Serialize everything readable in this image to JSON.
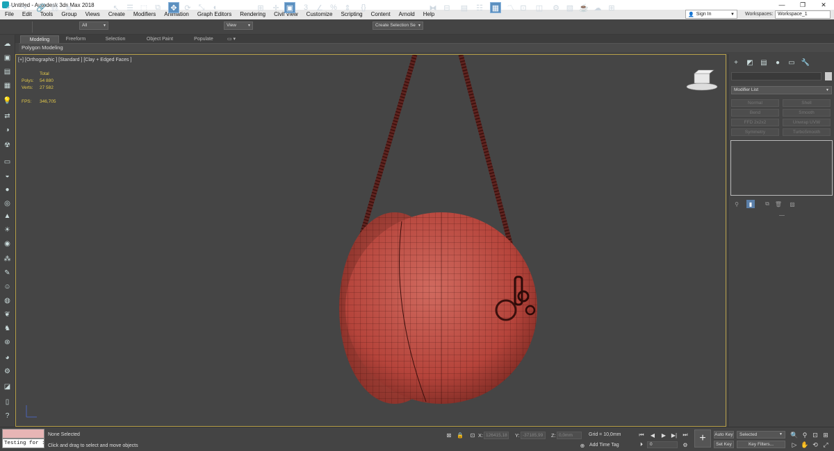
{
  "window": {
    "title": "Untitled - Autodesk 3ds Max 2018",
    "controls": [
      "—",
      "❐",
      "✕"
    ]
  },
  "menu": [
    "File",
    "Edit",
    "Tools",
    "Group",
    "Views",
    "Create",
    "Modifiers",
    "Animation",
    "Graph Editors",
    "Rendering",
    "Civil View",
    "Customize",
    "Scripting",
    "Content",
    "Arnold",
    "Help"
  ],
  "account": {
    "sign_in": "Sign In",
    "workspaces_label": "Workspaces:",
    "workspace": "Workspace_1"
  },
  "toolbar": {
    "selection_filter": "All",
    "reference_coord": "View",
    "named_selection": "Create Selection Se"
  },
  "ribbon": {
    "tabs": [
      "Modeling",
      "Freeform",
      "Selection",
      "Object Paint",
      "Populate"
    ],
    "active_tab": "Modeling",
    "sub_panel": "Polygon Modeling"
  },
  "viewport": {
    "label": "[+] [Orthographic ] [Standard ] [Clay + Edged Faces ]",
    "stats": {
      "total_label": "Total",
      "polys_label": "Polys:",
      "polys": "54 880",
      "verts_label": "Verts:",
      "verts": "27 582",
      "fps_label": "FPS:",
      "fps": "346,705"
    },
    "mesh_color": "#b5443b",
    "wire_color": "#3a0f0c"
  },
  "command_panel": {
    "modifier_list": "Modifier List",
    "modifier_buttons": [
      "Normal",
      "Shell",
      "Bend",
      "Smooth",
      "FFD 2x2x2",
      "Unwrap UVW",
      "Symmetry",
      "TurboSmooth"
    ]
  },
  "status": {
    "script_text": "Testing for :",
    "selection": "None Selected",
    "prompt": "Click and drag to select and move objects",
    "x_label": "X:",
    "x": "126415,18",
    "y_label": "Y:",
    "y": "-37185,99",
    "z_label": "Z:",
    "z": "0,0mm",
    "grid": "Grid = 10,0mm",
    "add_time_tag": "Add Time Tag",
    "frame": "0",
    "auto_key": "Auto Key",
    "set_key": "Set Key",
    "key_mode": "Selected",
    "key_filters": "Key Filters..."
  },
  "accent_color": "#b8a14a"
}
